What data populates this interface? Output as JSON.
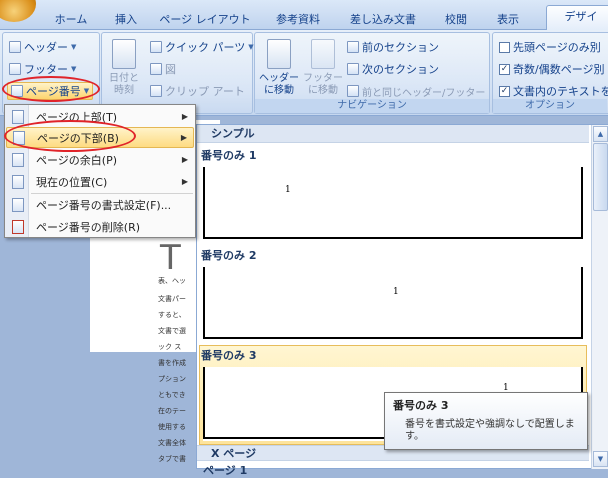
{
  "tabs": [
    {
      "label": "ホーム"
    },
    {
      "label": "挿入"
    },
    {
      "label": "ページ レイアウト"
    },
    {
      "label": "参考資料"
    },
    {
      "label": "差し込み文書"
    },
    {
      "label": "校閲"
    },
    {
      "label": "表示"
    },
    {
      "label": "デザイ"
    }
  ],
  "ribbon": {
    "header_footer": {
      "header_label": "ヘッダー",
      "footer_label": "フッター",
      "page_number_label": "ページ番号"
    },
    "insert": {
      "date_time_label_1": "日付と",
      "date_time_label_2": "時刻",
      "quick_parts_label": "クイック パーツ",
      "picture_label": "図",
      "clip_art_label": "クリップ アート"
    },
    "navigation": {
      "goto_header_1": "ヘッダー",
      "goto_header_2": "に移動",
      "goto_footer_1": "フッター",
      "goto_footer_2": "に移動",
      "prev_section": "前のセクション",
      "next_section": "次のセクション",
      "link_previous": "前と同じヘッダー/フッター",
      "group_label": "ナビゲーション"
    },
    "options": {
      "first_page_label": "先頭ページのみ別",
      "odd_even_label": "奇数/偶数ページ別",
      "show_text_label": "文書内のテキストを",
      "group_label": "オプション",
      "first_page_checked": false,
      "odd_even_checked": true,
      "show_text_checked": true
    }
  },
  "menu": {
    "items": [
      {
        "label": "ページの上部(T)",
        "has_submenu": true
      },
      {
        "label": "ページの下部(B)",
        "has_submenu": true
      },
      {
        "label": "ページの余白(P)",
        "has_submenu": true
      },
      {
        "label": "現在の位置(C)",
        "has_submenu": true
      },
      {
        "label": "ページ番号の書式設定(F)...",
        "has_submenu": false
      },
      {
        "label": "ページ番号の削除(R)",
        "has_submenu": false
      }
    ]
  },
  "gallery": {
    "section_title": "シンプル",
    "items": [
      {
        "title": "番号のみ 1",
        "number": "1"
      },
      {
        "title": "番号のみ 2",
        "number": "1"
      },
      {
        "title": "番号のみ 3",
        "number": "1"
      }
    ],
    "next_section_title": "X ページ",
    "next_item_title": "ページ 1"
  },
  "tooltip": {
    "title": "番号のみ 3",
    "body": "番号を書式設定や強調なしで配置します。"
  },
  "document": {
    "lines": [
      "表、ヘッ",
      "文書パー",
      "すると、",
      "文書で選",
      "ック ス",
      "書を作成",
      "プション",
      "ともでき",
      "在のテー",
      "使用する",
      "文書全体",
      "タブで書"
    ],
    "big_char": "T"
  },
  "colors": {
    "highlight": "#fedb82",
    "annotation_red": "#e0242a"
  }
}
